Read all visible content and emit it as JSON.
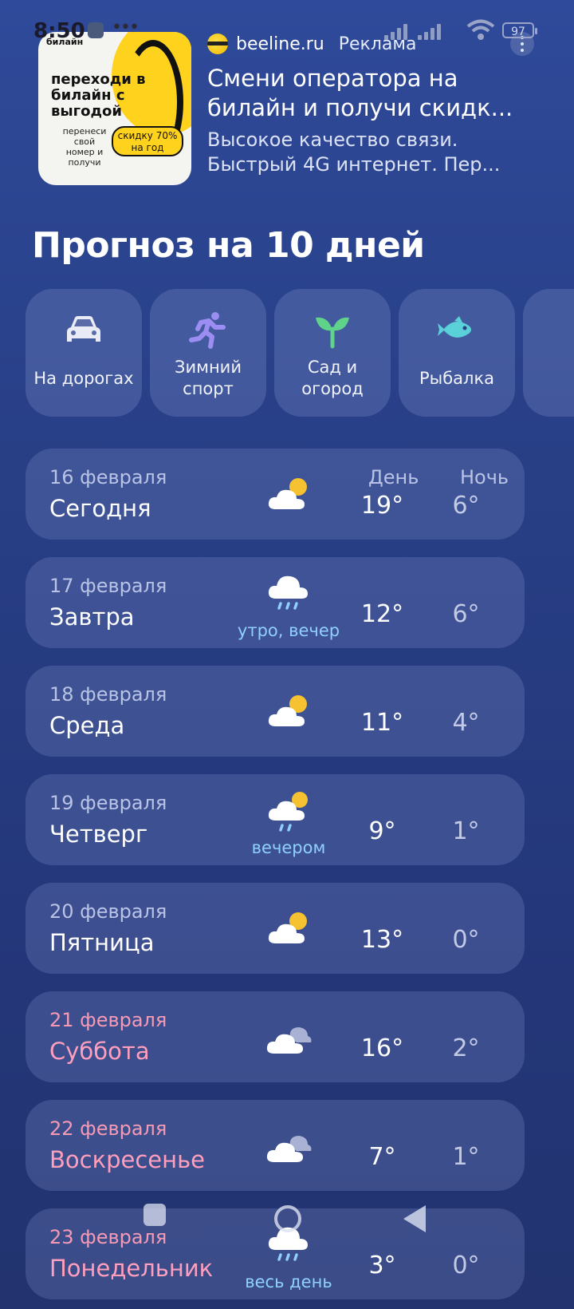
{
  "status": {
    "time": "8:50",
    "battery": "97"
  },
  "ad": {
    "image": {
      "brand": "билайн",
      "headline": "переходи в билайн с выгодой",
      "sub": "перенеси свой номер и получи",
      "badge": "скидку 70% на год"
    },
    "domain": "beeline.ru",
    "label": "Реклама",
    "title": "Смени оператора на билайн и получи скидк...",
    "description": "Высокое качество связи. Быстрый 4G интернет. Пер..."
  },
  "section_title": "Прогноз на 10 дней",
  "categories": [
    {
      "label": "На дорогах",
      "icon": "car-icon"
    },
    {
      "label": "Зимний спорт",
      "icon": "runner-icon"
    },
    {
      "label": "Сад и огород",
      "icon": "sprout-icon"
    },
    {
      "label": "Рыбалка",
      "icon": "fish-icon"
    }
  ],
  "headers": {
    "day": "День",
    "night": "Ночь"
  },
  "days": [
    {
      "date": "16 февраля",
      "name": "Сегодня",
      "icon": "partly-cloudy-icon",
      "note": "",
      "day": "19°",
      "night": "6°",
      "weekend": false
    },
    {
      "date": "17 февраля",
      "name": "Завтра",
      "icon": "cloud-rain-icon",
      "note": "утро, вечер",
      "day": "12°",
      "night": "6°",
      "weekend": false
    },
    {
      "date": "18 февраля",
      "name": "Среда",
      "icon": "partly-cloudy-icon",
      "note": "",
      "day": "11°",
      "night": "4°",
      "weekend": false
    },
    {
      "date": "19 февраля",
      "name": "Четверг",
      "icon": "partly-cloudy-rain-icon",
      "note": "вечером",
      "day": "9°",
      "night": "1°",
      "weekend": false
    },
    {
      "date": "20 февраля",
      "name": "Пятница",
      "icon": "partly-cloudy-icon",
      "note": "",
      "day": "13°",
      "night": "0°",
      "weekend": false
    },
    {
      "date": "21 февраля",
      "name": "Суббота",
      "icon": "cloudy-icon",
      "note": "",
      "day": "16°",
      "night": "2°",
      "weekend": true
    },
    {
      "date": "22 февраля",
      "name": "Воскресенье",
      "icon": "cloudy-icon",
      "note": "",
      "day": "7°",
      "night": "1°",
      "weekend": true
    },
    {
      "date": "23 февраля",
      "name": "Понедельник",
      "icon": "cloud-rain-icon",
      "note": "весь день",
      "day": "3°",
      "night": "0°",
      "weekend": true
    }
  ],
  "colors": {
    "background": "#283f86",
    "weekend_text": "#ff9fbd",
    "precip_note": "#8fd0ff",
    "sun": "#f6c231"
  }
}
